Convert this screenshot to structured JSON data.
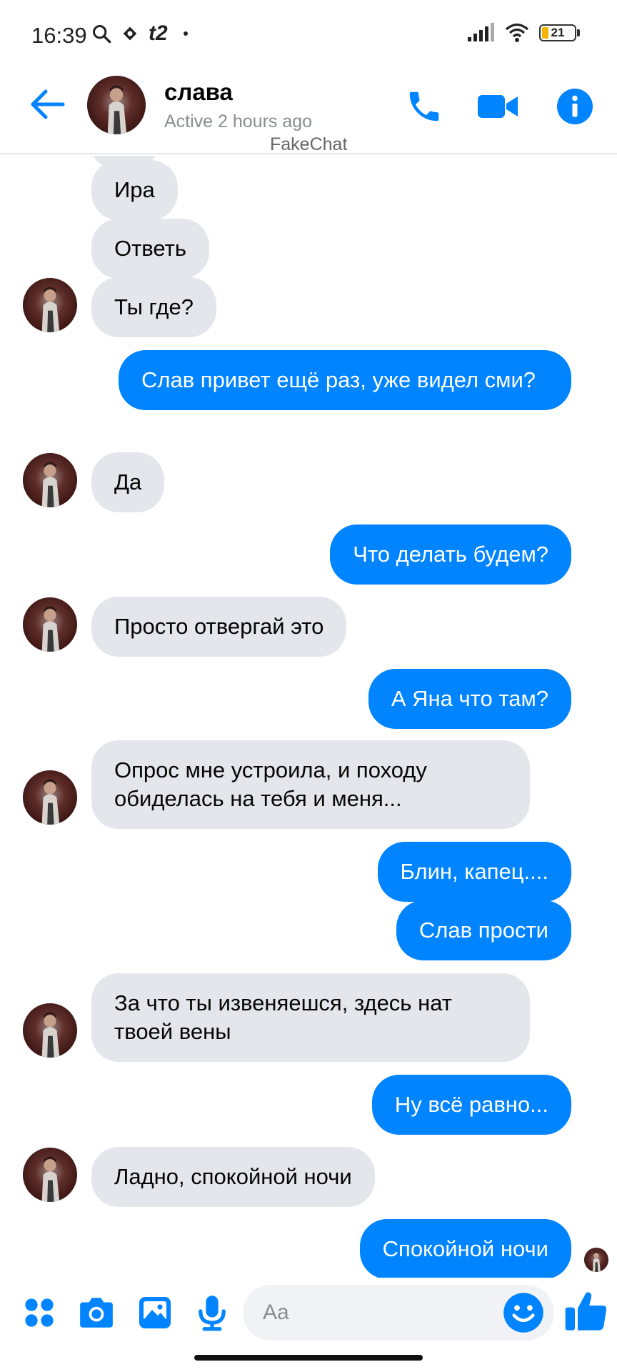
{
  "status_bar": {
    "time": "16:39",
    "carrier": "t2",
    "battery": "21",
    "battery_fraction": 0.21,
    "icons": [
      "search-icon",
      "game-icon",
      "carrier-logo",
      "dot-icon",
      "signal-icon",
      "wifi-icon",
      "battery-icon"
    ]
  },
  "header": {
    "name": "слава",
    "status": "Active 2 hours ago",
    "watermark": "FakeChat",
    "accent": "#0084ff"
  },
  "messages": [
    {
      "dir": "in",
      "text": "Ира"
    },
    {
      "dir": "in",
      "text": "Ответь"
    },
    {
      "dir": "in",
      "text": "Ты где?",
      "avatar": true
    },
    {
      "dir": "out",
      "text": "Слав привет ещё раз, уже видел сми?"
    },
    {
      "dir": "in",
      "text": "Да",
      "avatar": true
    },
    {
      "dir": "out",
      "text": "Что делать будем?"
    },
    {
      "dir": "in",
      "text": "Просто отвергай это",
      "avatar": true
    },
    {
      "dir": "out",
      "text": "А Яна что там?"
    },
    {
      "dir": "in",
      "text": "Опрос мне устроила, и походу обиделась на тебя и меня...",
      "avatar": true
    },
    {
      "dir": "out",
      "text": "Блин, капец...."
    },
    {
      "dir": "out",
      "text": "Слав прости"
    },
    {
      "dir": "in",
      "text": "За что ты извеняешся, здесь нат твоей вены",
      "avatar": true
    },
    {
      "dir": "out",
      "text": "Ну всё равно..."
    },
    {
      "dir": "in",
      "text": "Ладно, спокойной ночи",
      "avatar": true
    },
    {
      "dir": "out",
      "text": "Спокойной ночи",
      "seen": true
    }
  ],
  "composer": {
    "placeholder": "Aa",
    "icons": [
      "apps-icon",
      "camera-icon",
      "image-icon",
      "microphone-icon",
      "emoji-icon",
      "thumbs-up-icon"
    ]
  },
  "colors": {
    "outgoing_bubble": "#0084ff",
    "incoming_bubble": "#e4e6eb",
    "icon_blue": "#0084ff"
  }
}
